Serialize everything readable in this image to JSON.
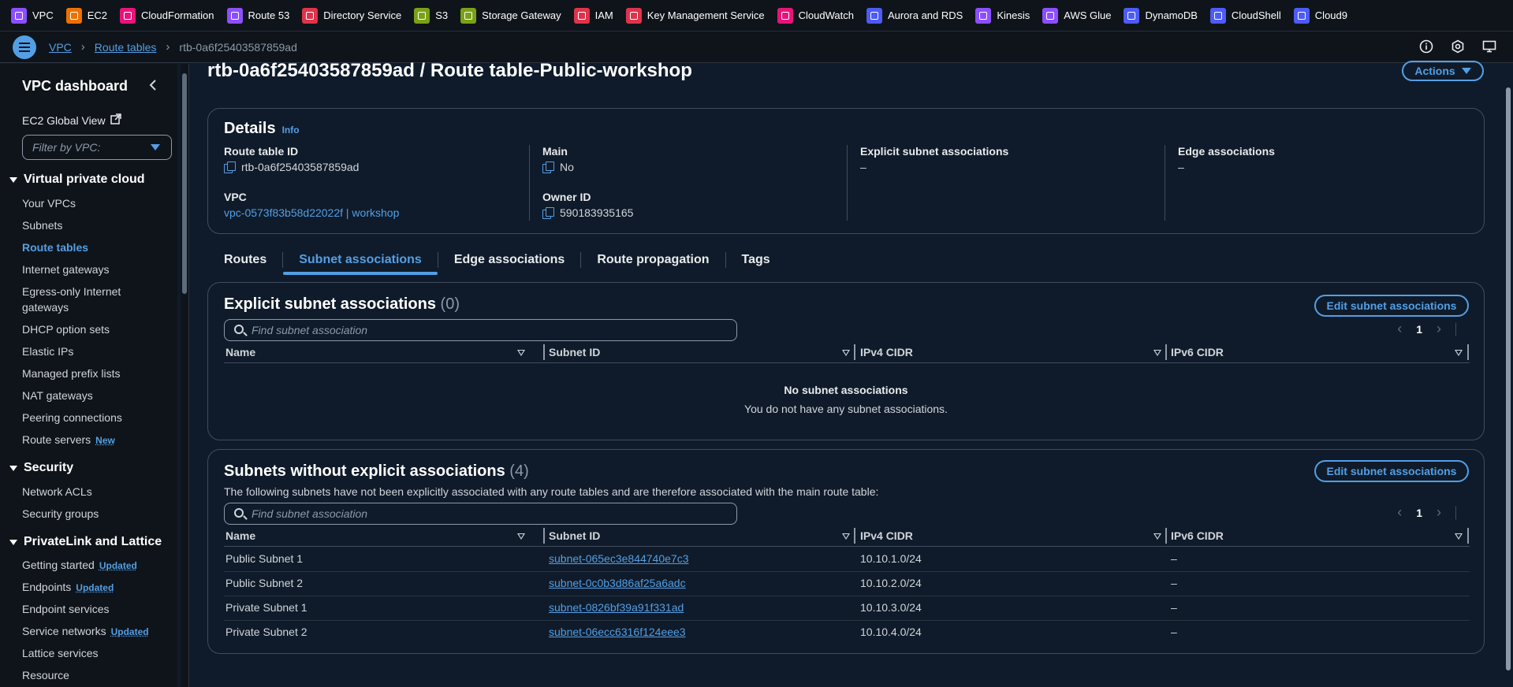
{
  "favorites": [
    {
      "label": "VPC",
      "color": "#8c4fff"
    },
    {
      "label": "EC2",
      "color": "#ed7100"
    },
    {
      "label": "CloudFormation",
      "color": "#e7157b"
    },
    {
      "label": "Route 53",
      "color": "#8c4fff"
    },
    {
      "label": "Directory Service",
      "color": "#dd344c"
    },
    {
      "label": "S3",
      "color": "#7aa116"
    },
    {
      "label": "Storage Gateway",
      "color": "#7aa116"
    },
    {
      "label": "IAM",
      "color": "#dd344c"
    },
    {
      "label": "Key Management Service",
      "color": "#dd344c"
    },
    {
      "label": "CloudWatch",
      "color": "#e7157b"
    },
    {
      "label": "Aurora and RDS",
      "color": "#4d5bf7"
    },
    {
      "label": "Kinesis",
      "color": "#8c4fff"
    },
    {
      "label": "AWS Glue",
      "color": "#8c4fff"
    },
    {
      "label": "DynamoDB",
      "color": "#4d5bf7"
    },
    {
      "label": "CloudShell",
      "color": "#4d5bf7"
    },
    {
      "label": "Cloud9",
      "color": "#4d5bf7"
    }
  ],
  "breadcrumb": {
    "items": [
      "VPC",
      "Route tables",
      "rtb-0a6f25403587859ad"
    ]
  },
  "sidebar": {
    "title": "VPC dashboard",
    "ec2_global_view": "EC2 Global View",
    "filter_placeholder": "Filter by VPC:",
    "sections": [
      {
        "label": "Virtual private cloud"
      },
      {
        "label": "Security"
      },
      {
        "label": "PrivateLink and Lattice"
      }
    ],
    "items": [
      {
        "label": "Your VPCs"
      },
      {
        "label": "Subnets"
      },
      {
        "label": "Route tables"
      },
      {
        "label": "Internet gateways"
      },
      {
        "label": "Egress-only Internet gateways"
      },
      {
        "label": "DHCP option sets"
      },
      {
        "label": "Elastic IPs"
      },
      {
        "label": "Managed prefix lists"
      },
      {
        "label": "NAT gateways"
      },
      {
        "label": "Peering connections"
      },
      {
        "label": "Route servers",
        "badge": "New"
      },
      {
        "label": "Network ACLs"
      },
      {
        "label": "Security groups"
      },
      {
        "label": "Getting started",
        "badge": "Updated"
      },
      {
        "label": "Endpoints",
        "badge": "Updated"
      },
      {
        "label": "Endpoint services"
      },
      {
        "label": "Service networks",
        "badge": "Updated"
      },
      {
        "label": "Lattice services"
      },
      {
        "label": "Resource"
      }
    ]
  },
  "page": {
    "title": "rtb-0a6f25403587859ad / Route table-Public-workshop",
    "actions_label": "Actions"
  },
  "details": {
    "title": "Details",
    "info": "Info",
    "route_table_id_label": "Route table ID",
    "route_table_id": "rtb-0a6f25403587859ad",
    "main_label": "Main",
    "main": "No",
    "explicit_label": "Explicit subnet associations",
    "explicit": "–",
    "edge_label": "Edge associations",
    "edge": "–",
    "vpc_label": "VPC",
    "vpc": "vpc-0573f83b58d22022f | workshop",
    "owner_label": "Owner ID",
    "owner": "590183935165"
  },
  "tabs": [
    "Routes",
    "Subnet associations",
    "Edge associations",
    "Route propagation",
    "Tags"
  ],
  "explicit_section": {
    "title": "Explicit subnet associations",
    "count": "(0)",
    "edit_label": "Edit subnet associations",
    "search_placeholder": "Find subnet association",
    "page": "1",
    "columns": [
      "Name",
      "Subnet ID",
      "IPv4 CIDR",
      "IPv6 CIDR"
    ],
    "empty_title": "No subnet associations",
    "empty_desc": "You do not have any subnet associations."
  },
  "implicit_section": {
    "title": "Subnets without explicit associations",
    "count": "(4)",
    "description": "The following subnets have not been explicitly associated with any route tables and are therefore associated with the main route table:",
    "edit_label": "Edit subnet associations",
    "search_placeholder": "Find subnet association",
    "page": "1",
    "columns": [
      "Name",
      "Subnet ID",
      "IPv4 CIDR",
      "IPv6 CIDR"
    ],
    "rows": [
      {
        "name": "Public Subnet 1",
        "subnet": "subnet-065ec3e844740e7c3",
        "ipv4": "10.10.1.0/24",
        "ipv6": "–"
      },
      {
        "name": "Public Subnet 2",
        "subnet": "subnet-0c0b3d86af25a6adc",
        "ipv4": "10.10.2.0/24",
        "ipv6": "–"
      },
      {
        "name": "Private Subnet 1",
        "subnet": "subnet-0826bf39a91f331ad",
        "ipv4": "10.10.3.0/24",
        "ipv6": "–"
      },
      {
        "name": "Private Subnet 2",
        "subnet": "subnet-06ecc6316f124eee3",
        "ipv4": "10.10.4.0/24",
        "ipv6": "–"
      }
    ]
  }
}
